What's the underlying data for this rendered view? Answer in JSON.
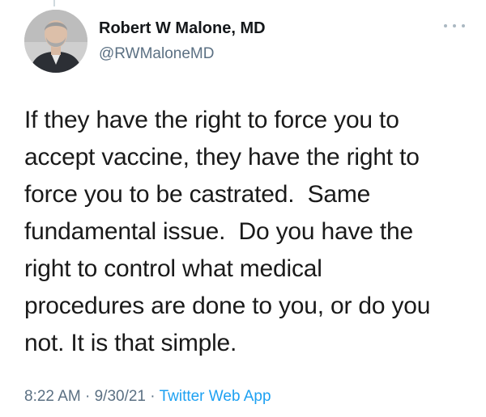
{
  "author": {
    "display_name": "Robert W Malone, MD",
    "handle": "@RWMaloneMD",
    "avatar_icon": "profile-photo"
  },
  "tweet": {
    "text": "If they have the right to force you to\naccept vaccine, they have the right to\nforce you to be castrated.  Same\nfundamental issue.  Do you have the\nright to control what medical\nprocedures are done to you, or do you\nnot. It is that simple."
  },
  "meta": {
    "time": "8:22 AM",
    "separator": " · ",
    "date": "9/30/21",
    "source": "Twitter Web App"
  },
  "colors": {
    "handle": "#5b7083",
    "link": "#1da1f2",
    "text": "#14171a"
  }
}
